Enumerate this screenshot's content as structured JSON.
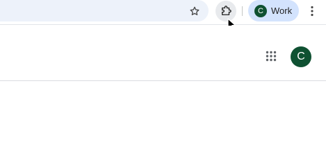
{
  "toolbar": {
    "bookmark_icon": "star-outline-icon",
    "extensions_icon": "puzzle-piece-icon",
    "profile": {
      "avatar_letter": "C",
      "label": "Work",
      "avatar_color": "#0f5132",
      "chip_color": "#d3e3fd"
    },
    "menu_icon": "vertical-dots-icon"
  },
  "header": {
    "apps_icon": "apps-grid-icon",
    "account_avatar_letter": "C",
    "account_avatar_color": "#0f5132"
  },
  "colors": {
    "omnibox_bg": "#edf2fa",
    "extension_hover_bg": "#e8eaed"
  }
}
